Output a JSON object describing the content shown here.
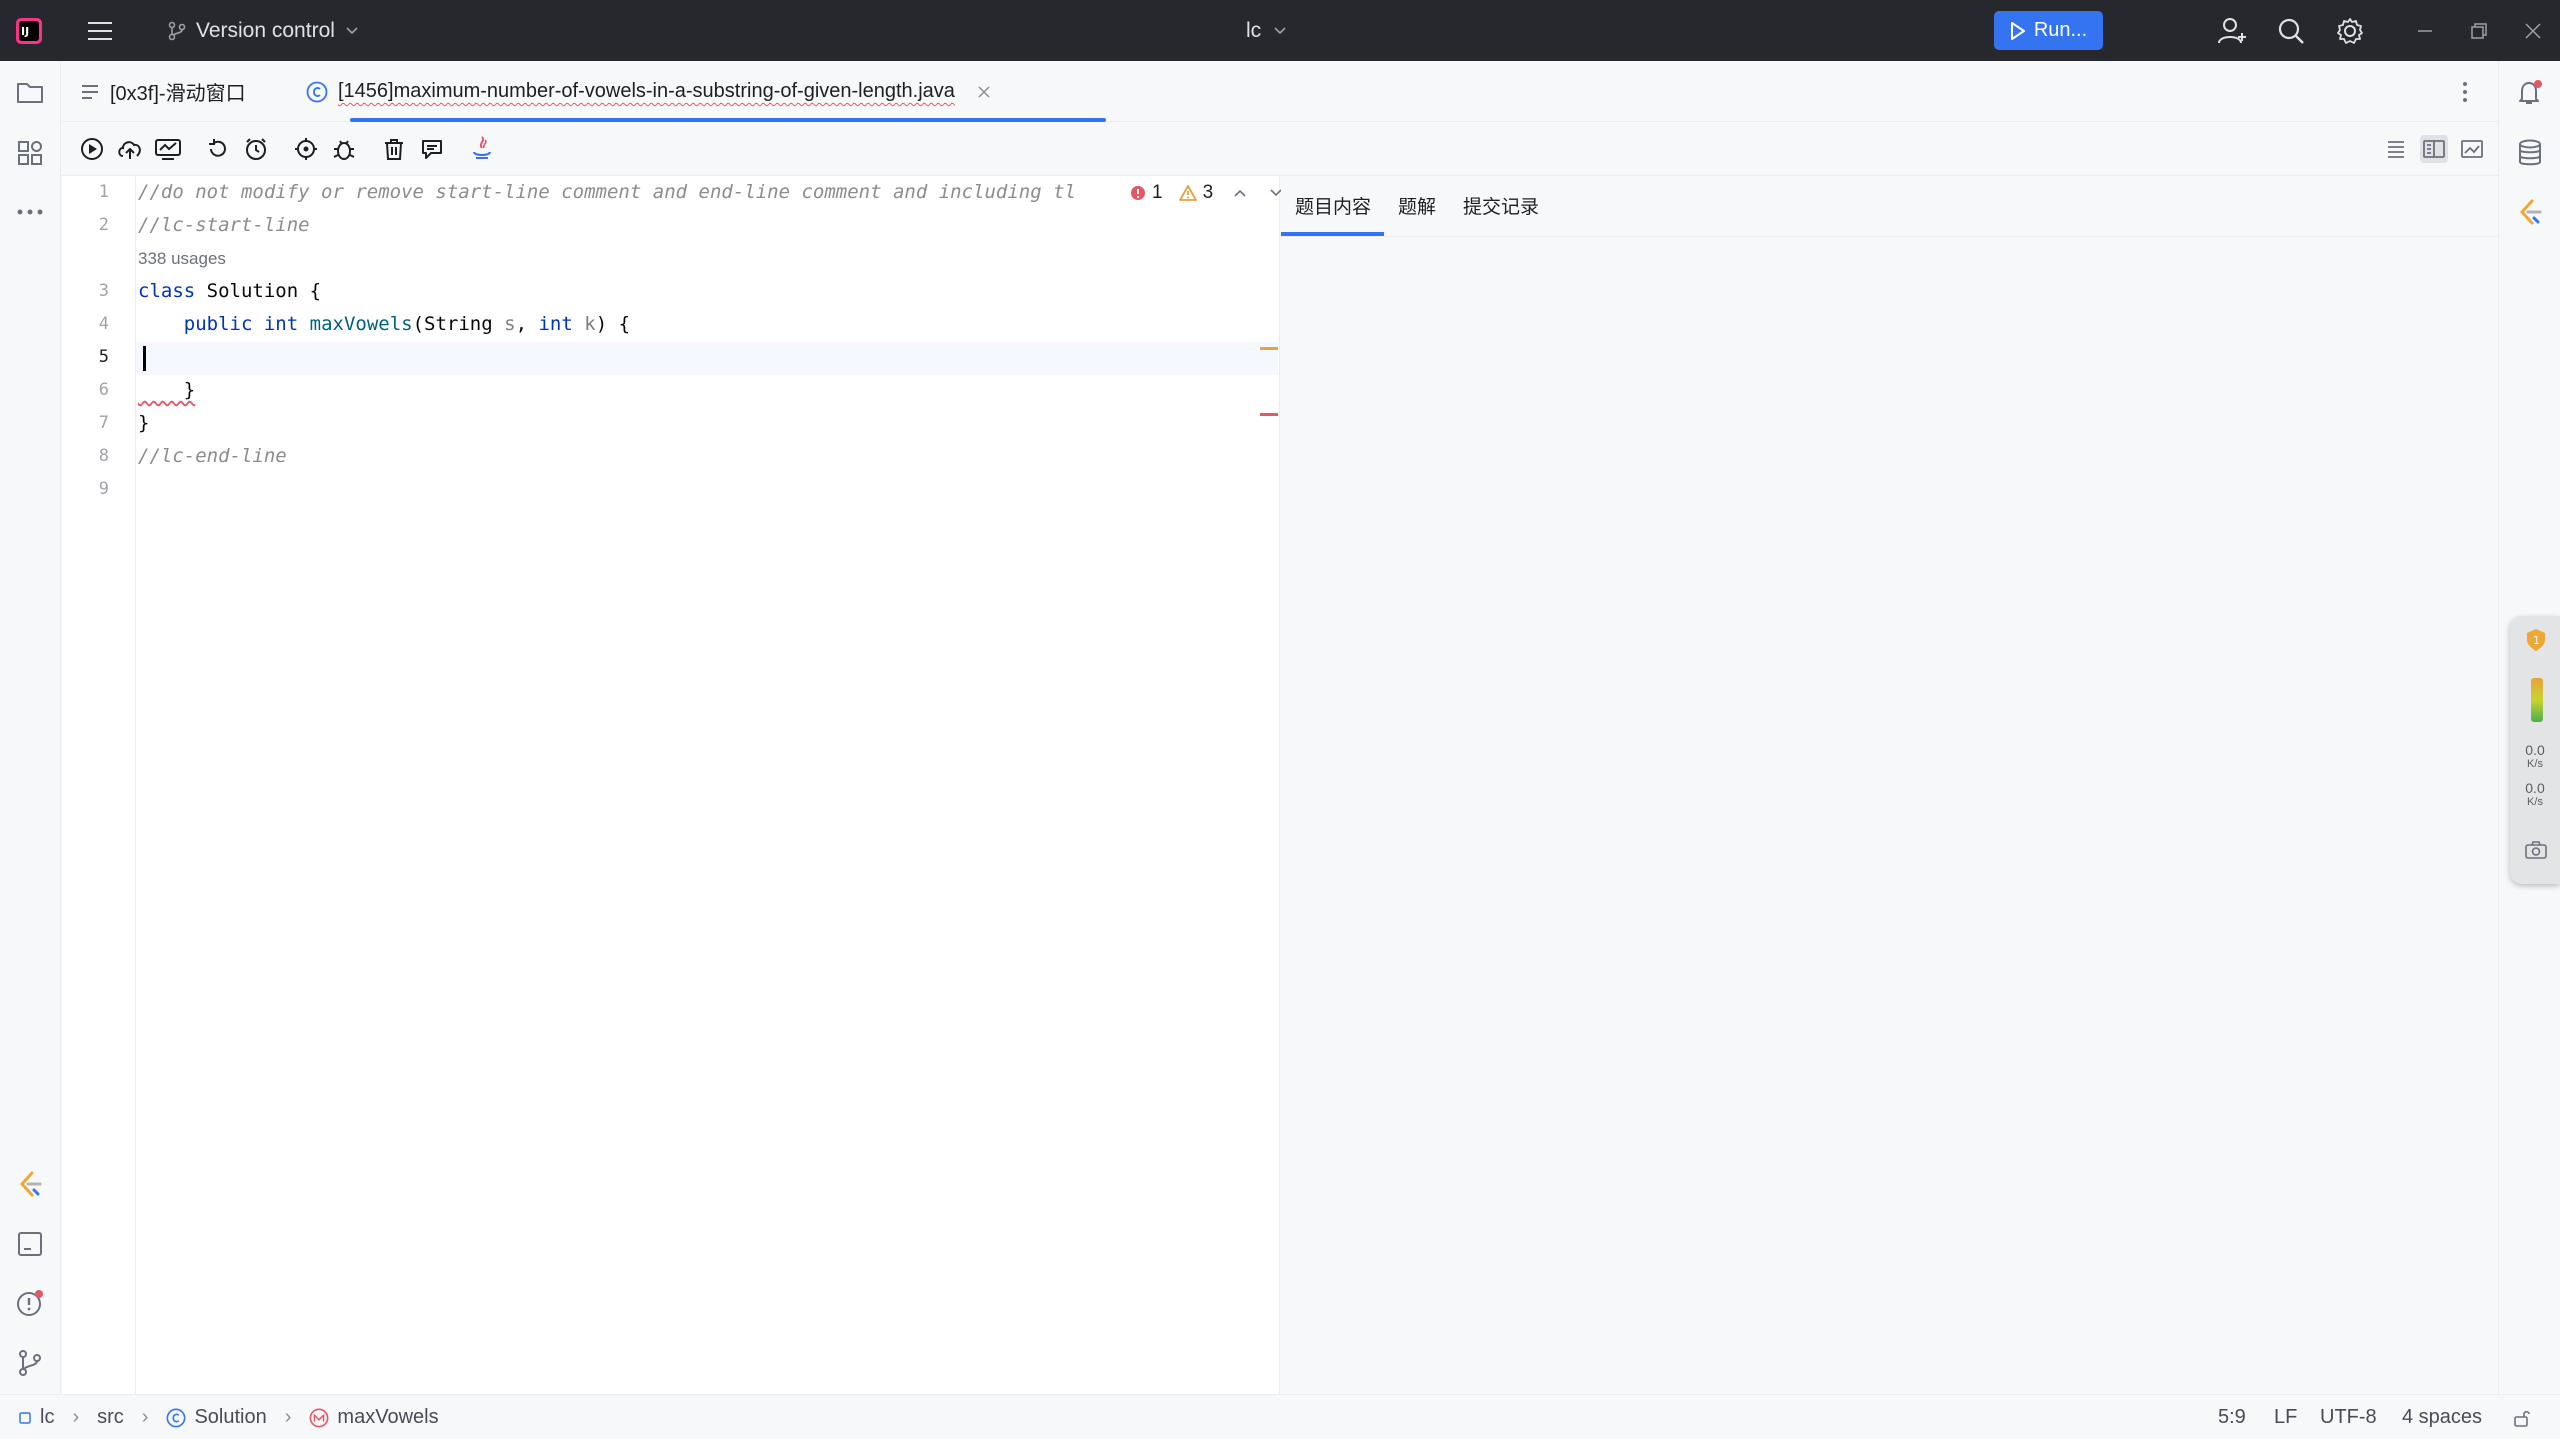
{
  "titlebar": {
    "vcs_label": "Version control",
    "project": "lc",
    "run_label": "Run..."
  },
  "tabs": [
    {
      "label": "[0x3f]-滑动窗口",
      "active": false
    },
    {
      "label": "[1456]maximum-number-of-vowels-in-a-substring-of-given-length.java",
      "active": true
    }
  ],
  "editor": {
    "line_numbers": [
      "1",
      "2",
      "3",
      "4",
      "5",
      "6",
      "7",
      "8",
      "9"
    ],
    "usages_hint": "338 usages",
    "line1": "//do not modify or remove start-line comment and end-line comment and including tl",
    "line2": "//lc-start-line",
    "line3_kw": "class",
    "line3_rest": " Solution {",
    "line4_indent": "    ",
    "line4_public": "public",
    "line4_int": "int",
    "line4_method": "maxVowels",
    "line4_paren": "(String ",
    "line4_s": "s",
    "line4_comma": ", ",
    "line4_int2": "int",
    "line4_k": "k",
    "line4_end": ") {",
    "line6": "    }",
    "line7": "}",
    "line8": "//lc-end-line",
    "errors": "1",
    "warnings": "3"
  },
  "right_panel": {
    "tabs": [
      "题目内容",
      "题解",
      "提交记录"
    ]
  },
  "widget": {
    "up_speed": "0.0",
    "up_unit": "K/s",
    "down_speed": "0.0",
    "down_unit": "K/s"
  },
  "statusbar": {
    "breadcrumbs": [
      "lc",
      "src",
      "Solution",
      "maxVowels"
    ],
    "position": "5:9",
    "line_sep": "LF",
    "encoding": "UTF-8",
    "indent": "4 spaces"
  },
  "colors": {
    "accent": "#3574f0",
    "titlebar_bg": "#27282e",
    "error": "#e55765",
    "warning": "#e6a23c"
  }
}
